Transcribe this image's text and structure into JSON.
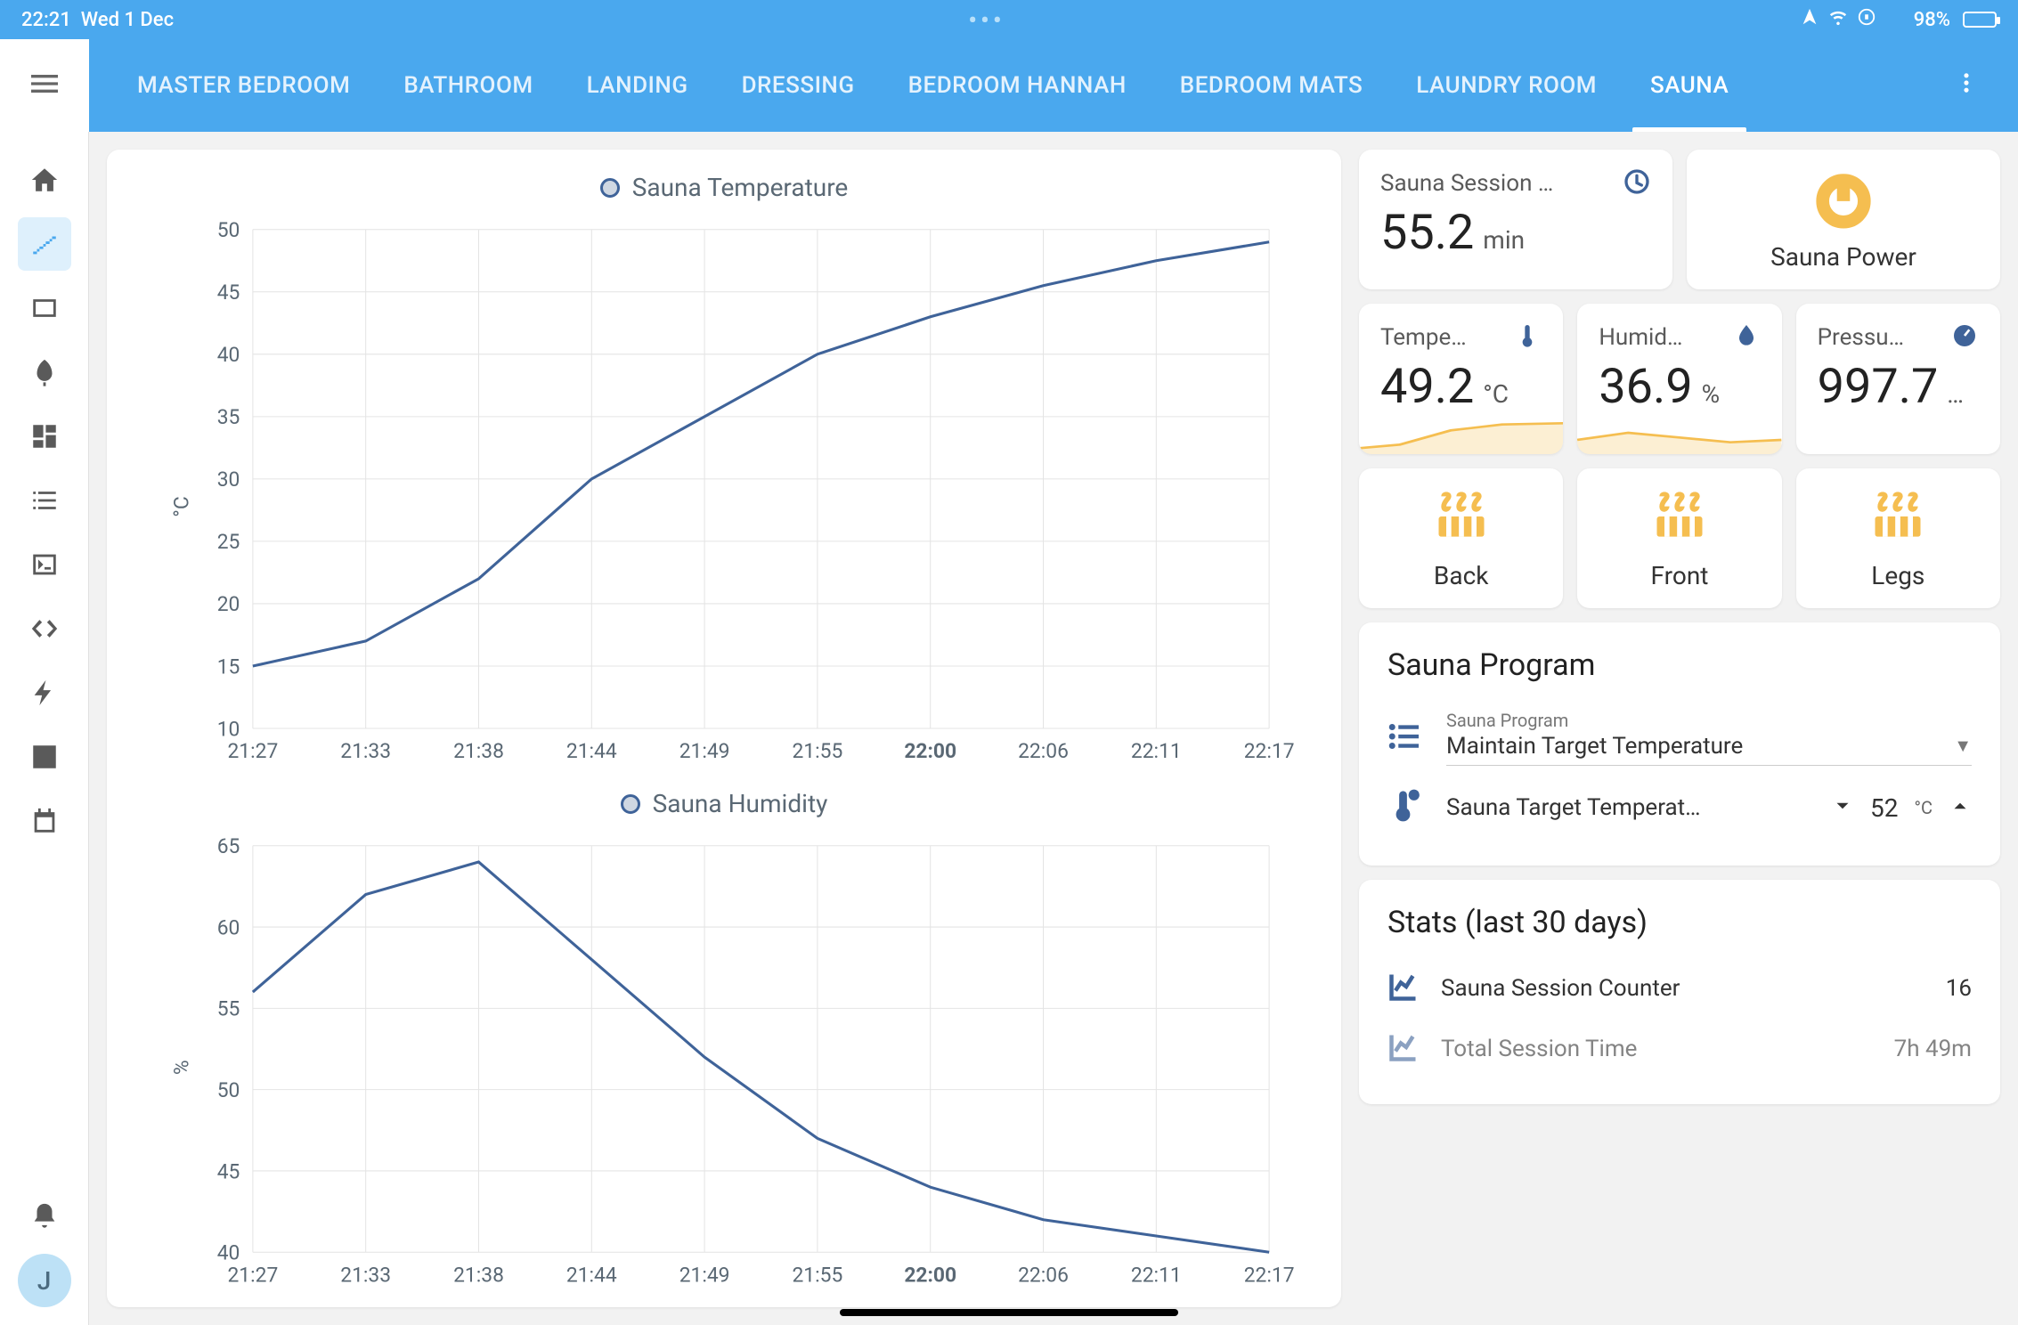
{
  "status": {
    "time": "22:21",
    "date": "Wed 1 Dec",
    "battery": "98%"
  },
  "tabs": [
    "MASTER BEDROOM",
    "BATHROOM",
    "LANDING",
    "DRESSING",
    "BEDROOM HANNAH",
    "BEDROOM MATS",
    "LAUNDRY ROOM",
    "SAUNA"
  ],
  "active_tab": 7,
  "avatar_initial": "J",
  "session_card": {
    "title": "Sauna Session …",
    "value": "55.2",
    "unit": "min"
  },
  "power_card": {
    "label": "Sauna Power"
  },
  "sensor_cards": {
    "temp": {
      "title": "Tempe…",
      "value": "49.2",
      "unit": "°C"
    },
    "humid": {
      "title": "Humid…",
      "value": "36.9",
      "unit": "%"
    },
    "press": {
      "title": "Pressu…",
      "value": "997.7",
      "unit": "…"
    }
  },
  "heaters": [
    "Back",
    "Front",
    "Legs"
  ],
  "program_panel": {
    "title": "Sauna Program",
    "select_label": "Sauna Program",
    "select_value": "Maintain Target Temperature",
    "target_label": "Sauna Target Temperat…",
    "target_value": "52",
    "target_unit": "°C"
  },
  "stats_panel": {
    "title": "Stats (last 30 days)",
    "rows": [
      {
        "label": "Sauna Session Counter",
        "value": "16"
      },
      {
        "label": "Total Session Time",
        "value": "7h 49m"
      }
    ]
  },
  "chart_data": [
    {
      "type": "line",
      "title": "Sauna Temperature",
      "ylabel": "°C",
      "x": [
        "21:27",
        "21:33",
        "21:38",
        "21:44",
        "21:49",
        "21:55",
        "22:00",
        "22:06",
        "22:11",
        "22:17"
      ],
      "y": [
        15,
        17,
        22,
        30,
        35,
        40,
        43,
        45.5,
        47.5,
        49
      ],
      "ylim": [
        10,
        50
      ]
    },
    {
      "type": "line",
      "title": "Sauna Humidity",
      "ylabel": "%",
      "x": [
        "21:27",
        "21:33",
        "21:38",
        "21:44",
        "21:49",
        "21:55",
        "22:00",
        "22:06",
        "22:11",
        "22:17"
      ],
      "y": [
        56,
        62,
        64,
        58,
        52,
        47,
        44,
        42,
        41,
        40
      ],
      "ylim": [
        40,
        65
      ]
    }
  ]
}
